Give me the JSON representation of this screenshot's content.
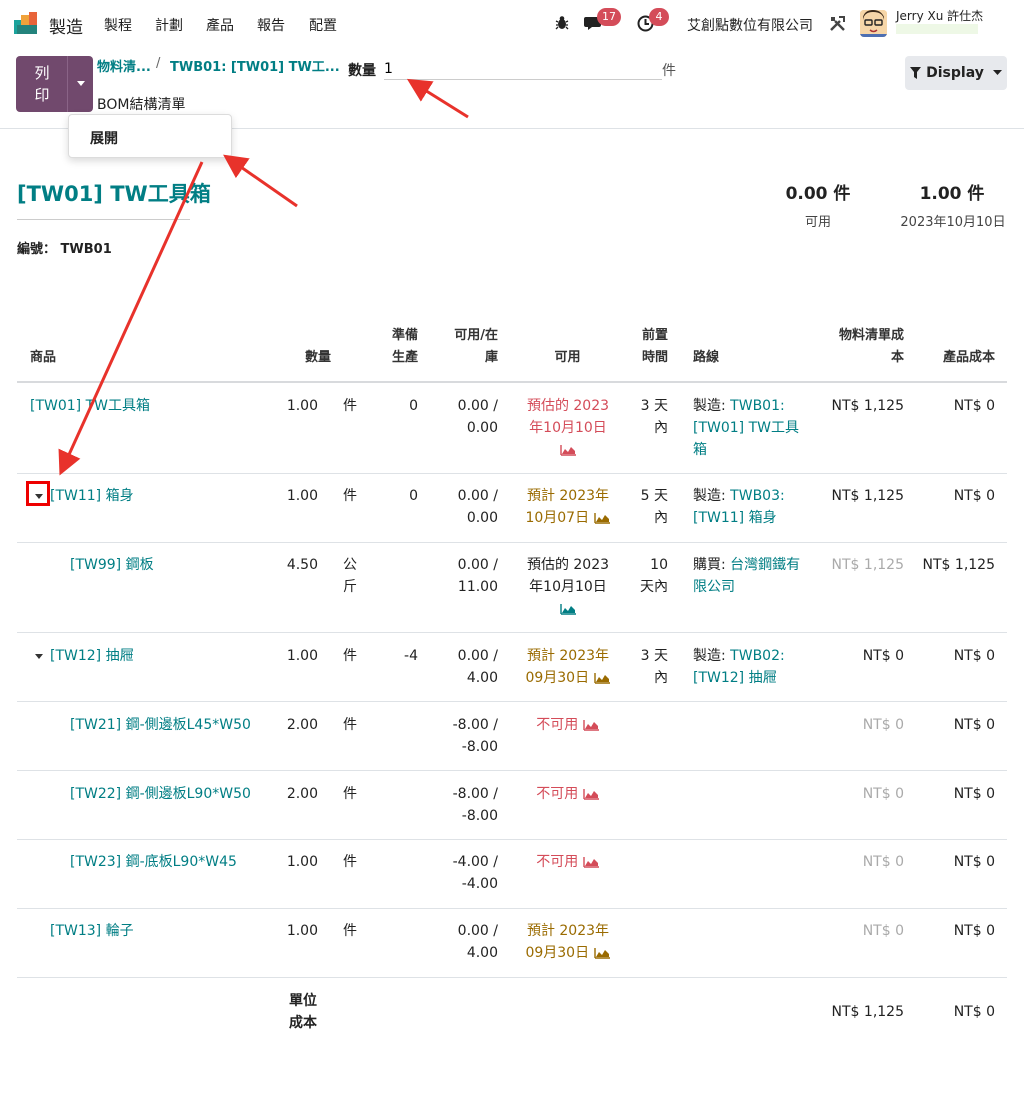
{
  "nav": {
    "app_name": "製造",
    "menu": [
      "製程",
      "計劃",
      "產品",
      "報告",
      "配置"
    ],
    "messages_count": "17",
    "activities_count": "4",
    "company": "艾創點數位有限公司",
    "user": "Jerry Xu 許仕杰"
  },
  "control": {
    "print_label": "列印",
    "breadcrumb_1": "物料清...",
    "breadcrumb_sep": "/",
    "breadcrumb_2": "TWB01: [TW01] TW工...",
    "page_title": "BOM結構清單",
    "quantity_label": "數量",
    "quantity_value": "1",
    "quantity_unit": "件",
    "display_label": "Display",
    "dropdown_item": "展開"
  },
  "report": {
    "title": "[TW01] TW工具箱",
    "reference_label": "編號：",
    "reference_value": "TWB01",
    "available_qty": "0.00 件",
    "available_label": "可用",
    "date_qty": "1.00 件",
    "date_label": "2023年10月10日"
  },
  "table": {
    "headers": {
      "product": "商品",
      "quantity": "數量",
      "ready_1": "準備",
      "ready_2": "生產",
      "onhand_1": "可用/在",
      "onhand_2": "庫",
      "available": "可用",
      "lead_1": "前置",
      "lead_2": "時間",
      "route": "路線",
      "bom_cost_1": "物料清單成",
      "bom_cost_2": "本",
      "product_cost": "產品成本"
    },
    "rows": [
      {
        "product": "[TW01] TW工具箱",
        "qty": "1.00",
        "uom": "件",
        "ready": "0",
        "onhand_1": "0.00 /",
        "onhand_2": "0.00",
        "avail_1": "預估的 2023",
        "avail_2": "年10月10日",
        "lead_1": "3 天",
        "lead_2": "內",
        "route_prefix": "製造:",
        "route_1": "TWB01:",
        "route_2": "[TW01] TW工具",
        "route_3": "箱",
        "bom_cost": "NT$ 1,125",
        "prod_cost": "NT$ 0"
      },
      {
        "product": "[TW11] 箱身",
        "qty": "1.00",
        "uom": "件",
        "ready": "0",
        "onhand_1": "0.00 /",
        "onhand_2": "0.00",
        "avail_1": "預計 2023年",
        "avail_2": "10月07日",
        "lead_1": "5 天",
        "lead_2": "內",
        "route_prefix": "製造:",
        "route_1": "TWB03:",
        "route_2": "[TW11] 箱身",
        "bom_cost": "NT$ 1,125",
        "prod_cost": "NT$ 0"
      },
      {
        "product": "[TW99] 鋼板",
        "qty": "4.50",
        "uom_1": "公",
        "uom_2": "斤",
        "onhand_1": "0.00 /",
        "onhand_2": "11.00",
        "avail_1": "預估的 2023",
        "avail_2": "年10月10日",
        "lead_1": "10",
        "lead_2": "天內",
        "route_prefix": "購買:",
        "route_1": "台灣鋼鐵有",
        "route_2": "限公司",
        "bom_cost": "NT$ 1,125",
        "prod_cost": "NT$ 1,125"
      },
      {
        "product": "[TW12] 抽屜",
        "qty": "1.00",
        "uom": "件",
        "ready": "-4",
        "onhand_1": "0.00 /",
        "onhand_2": "4.00",
        "avail_1": "預計 2023年",
        "avail_2": "09月30日",
        "lead_1": "3 天",
        "lead_2": "內",
        "route_prefix": "製造:",
        "route_1": "TWB02:",
        "route_2": "[TW12] 抽屜",
        "bom_cost": "NT$ 0",
        "prod_cost": "NT$ 0"
      },
      {
        "product": "[TW21] 鋼-側邊板L45*W50",
        "qty": "2.00",
        "uom": "件",
        "onhand_1": "-8.00 /",
        "onhand_2": "-8.00",
        "avail_1": "不可用",
        "bom_cost": "NT$ 0",
        "prod_cost": "NT$ 0"
      },
      {
        "product": "[TW22] 鋼-側邊板L90*W50",
        "qty": "2.00",
        "uom": "件",
        "onhand_1": "-8.00 /",
        "onhand_2": "-8.00",
        "avail_1": "不可用",
        "bom_cost": "NT$ 0",
        "prod_cost": "NT$ 0"
      },
      {
        "product": "[TW23] 鋼-底板L90*W45",
        "qty": "1.00",
        "uom": "件",
        "onhand_1": "-4.00 /",
        "onhand_2": "-4.00",
        "avail_1": "不可用",
        "bom_cost": "NT$ 0",
        "prod_cost": "NT$ 0"
      },
      {
        "product": "[TW13] 輪子",
        "qty": "1.00",
        "uom": "件",
        "onhand_1": "0.00 /",
        "onhand_2": "4.00",
        "avail_1": "預計 2023年",
        "avail_2": "09月30日",
        "bom_cost": "NT$ 0",
        "prod_cost": "NT$ 0"
      }
    ],
    "footer": {
      "label_1": "單位",
      "label_2": "成本",
      "bom_cost": "NT$ 1,125",
      "prod_cost": "NT$ 0"
    }
  },
  "colors": {
    "teal": "#017e84",
    "red": "#d44c59",
    "gold": "#9a6b01",
    "purple": "#71496d",
    "annotation": "#e8322b"
  },
  "icons": [
    "bug-icon",
    "chat-icon",
    "clock-icon",
    "tools-icon",
    "filter-icon",
    "chart-area-icon",
    "caret-down-icon"
  ]
}
